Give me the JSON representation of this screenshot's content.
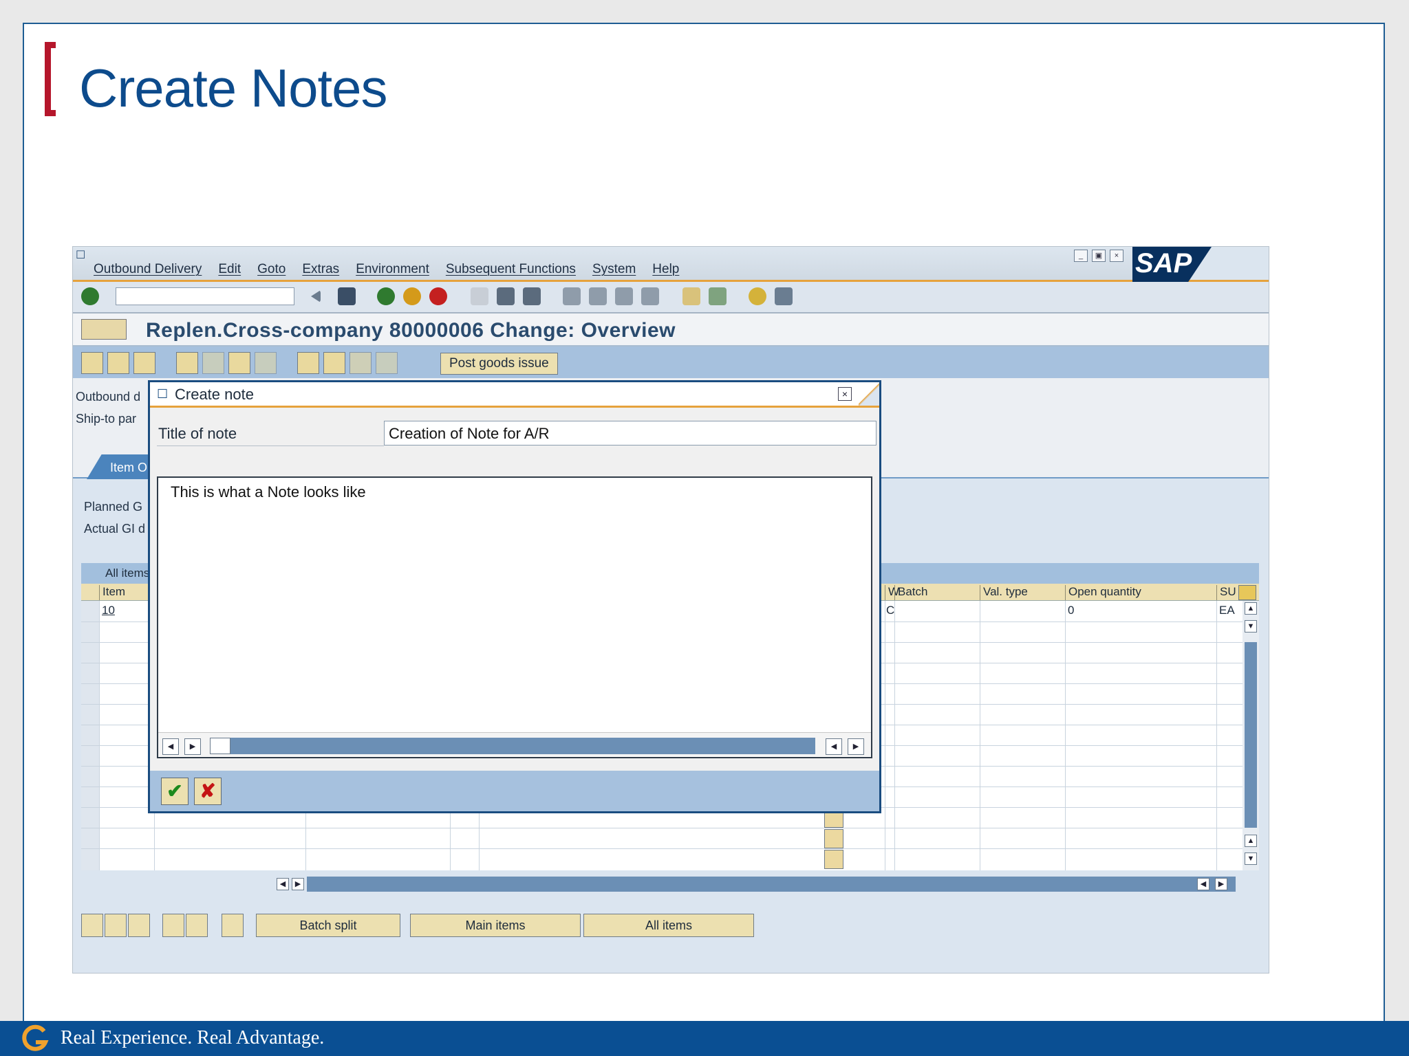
{
  "slide": {
    "title": "Create Notes",
    "footer_text": "Real Experience. Real Advantage."
  },
  "sap": {
    "menu": [
      "Outbound Delivery",
      "Edit",
      "Goto",
      "Extras",
      "Environment",
      "Subsequent Functions",
      "System",
      "Help"
    ],
    "logo_text": "SAP",
    "screen_title": "Replen.Cross-company 80000006 Change: Overview",
    "post_goods_issue_label": "Post goods issue",
    "header_labels": {
      "outbound": "Outbound d",
      "ship_to": "Ship-to par"
    },
    "tab_label": "Item O",
    "planned_label": "Planned G",
    "actual_label": "Actual GI d",
    "all_items_header": "All items",
    "columns": {
      "item": "Item",
      "w": "W",
      "batch": "Batch",
      "val_type": "Val. type",
      "open_qty": "Open quantity",
      "su": "SU"
    },
    "row1": {
      "item": "10",
      "w": "C",
      "open_qty": "0",
      "su": "EA"
    },
    "bottom_buttons": {
      "batch_split": "Batch split",
      "main_items": "Main items",
      "all_items": "All items"
    }
  },
  "dialog": {
    "title": "Create note",
    "title_of_note_label": "Title of note",
    "title_of_note_value": "Creation of Note for A/R",
    "note_body": "This is what a Note looks like"
  },
  "colors": {
    "slide_title": "#0d4b8c",
    "bracket": "#b5162b",
    "footer_bg": "#0a4f93",
    "sap_accent": "#e6a23c",
    "toolbar_blue": "#a6c1de"
  }
}
